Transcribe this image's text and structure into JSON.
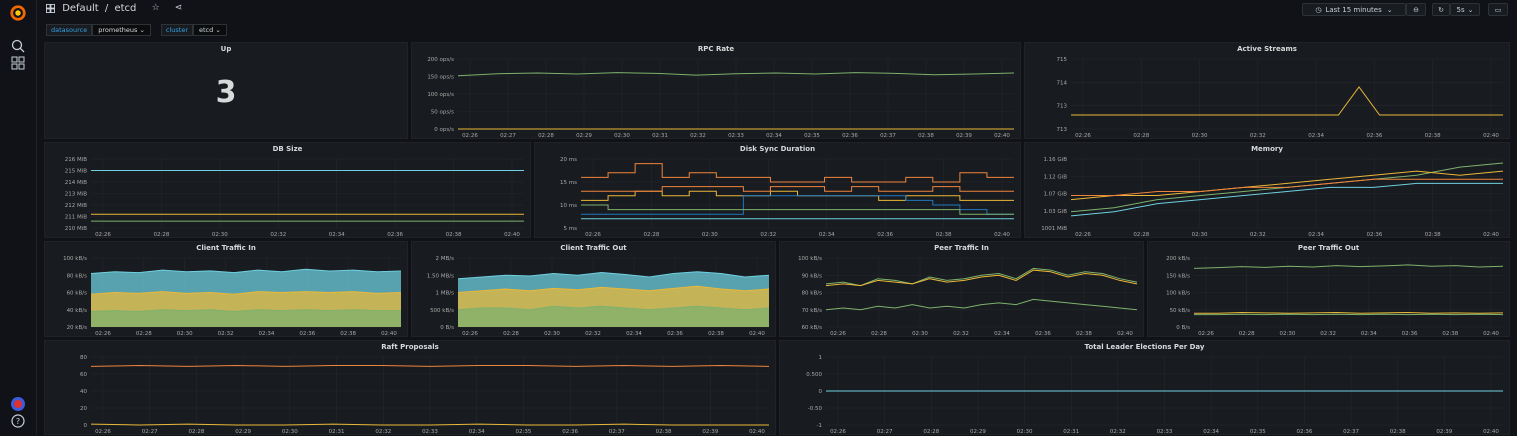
{
  "header": {
    "folder": "Default",
    "separator": "/",
    "title": "etcd",
    "time_range": "Last 15 minutes",
    "refresh": "5s"
  },
  "variables": [
    {
      "label": "datasource",
      "value": "prometheus"
    },
    {
      "label": "cluster",
      "value": "etcd"
    }
  ],
  "colors": {
    "green": "#7eb26d",
    "yellow": "#eab839",
    "orange": "#ef843c",
    "blue": "#6ed0e0",
    "lightblue": "#1f78c1",
    "grid": "#25272b"
  },
  "panels": {
    "up": {
      "title": "Up",
      "value": "3"
    },
    "rpc": {
      "title": "RPC Rate"
    },
    "streams": {
      "title": "Active Streams"
    },
    "dbsize": {
      "title": "DB Size"
    },
    "disk": {
      "title": "Disk Sync Duration"
    },
    "memory": {
      "title": "Memory"
    },
    "cin": {
      "title": "Client Traffic In"
    },
    "cout": {
      "title": "Client Traffic Out"
    },
    "pin": {
      "title": "Peer Traffic In"
    },
    "pout": {
      "title": "Peer Traffic Out"
    },
    "raft": {
      "title": "Raft Proposals"
    },
    "leader": {
      "title": "Total Leader Elections Per Day"
    }
  },
  "chart_data": [
    {
      "id": "rpc",
      "type": "line",
      "x": [
        "02:26",
        "02:27",
        "02:28",
        "02:29",
        "02:30",
        "02:31",
        "02:32",
        "02:33",
        "02:34",
        "02:35",
        "02:36",
        "02:37",
        "02:38",
        "02:39",
        "02:40"
      ],
      "yticks": [
        "200 ops/s",
        "150 ops/s",
        "100 ops/s",
        "50 ops/s",
        "0 ops/s"
      ],
      "ylim": [
        0,
        200
      ],
      "series": [
        {
          "color": "green",
          "values": [
            152,
            158,
            160,
            157,
            161,
            159,
            154,
            158,
            160,
            157,
            161,
            159,
            155,
            157,
            160
          ]
        },
        {
          "color": "yellow",
          "values": [
            0,
            0,
            0,
            0,
            0,
            0,
            0,
            0,
            0,
            0,
            0,
            0,
            0,
            0,
            0
          ]
        }
      ]
    },
    {
      "id": "streams",
      "type": "line",
      "x": [
        "02:26",
        "02:28",
        "02:30",
        "02:32",
        "02:34",
        "02:36",
        "02:38",
        "02:40"
      ],
      "yticks": [
        "715",
        "714",
        "713",
        "713"
      ],
      "ylim": [
        712.5,
        715
      ],
      "series": [
        {
          "color": "yellow",
          "values": [
            713,
            713,
            713,
            713,
            713,
            713,
            713,
            713,
            713,
            713,
            713,
            713,
            713,
            713,
            714,
            713,
            713,
            713,
            713,
            713,
            713,
            713
          ]
        }
      ]
    },
    {
      "id": "dbsize",
      "type": "line",
      "x": [
        "02:26",
        "02:28",
        "02:30",
        "02:32",
        "02:34",
        "02:36",
        "02:38",
        "02:40"
      ],
      "yticks": [
        "216 MiB",
        "215 MiB",
        "214 MiB",
        "213 MiB",
        "212 MiB",
        "211 MiB",
        "210 MiB"
      ],
      "ylim": [
        210,
        216
      ],
      "series": [
        {
          "color": "blue",
          "values": [
            215,
            215,
            215,
            215,
            215,
            215,
            215,
            215
          ]
        },
        {
          "color": "yellow",
          "values": [
            211.2,
            211.2,
            211.2,
            211.2,
            211.2,
            211.2,
            211.2,
            211.2
          ]
        },
        {
          "color": "green",
          "values": [
            210.6,
            210.6,
            210.6,
            210.6,
            210.6,
            210.6,
            210.6,
            210.6
          ]
        }
      ]
    },
    {
      "id": "disk",
      "type": "step",
      "x": [
        "02:26",
        "02:28",
        "02:30",
        "02:32",
        "02:34",
        "02:36",
        "02:38",
        "02:40"
      ],
      "yticks": [
        "20 ms",
        "15 ms",
        "10 ms",
        "5 ms"
      ],
      "ylim": [
        5,
        20
      ],
      "series": [
        {
          "color": "orange",
          "values": [
            16,
            17,
            19,
            16,
            17,
            16,
            16,
            15,
            15,
            16,
            15,
            15,
            16,
            15,
            17,
            16
          ]
        },
        {
          "color": "yellow",
          "values": [
            11,
            12,
            13,
            12,
            13,
            12,
            12,
            13,
            12,
            12,
            12,
            11,
            12,
            12,
            11,
            11
          ]
        },
        {
          "color": "orange",
          "values": [
            13,
            13,
            13,
            14,
            14,
            14,
            13,
            14,
            14,
            13,
            14,
            13,
            13,
            14,
            13,
            13
          ]
        },
        {
          "color": "lightblue",
          "values": [
            8,
            8,
            8,
            8,
            8,
            8,
            12,
            12,
            12,
            12,
            12,
            12,
            11,
            10,
            9,
            8
          ]
        },
        {
          "color": "blue",
          "values": [
            7,
            7,
            7,
            7,
            7,
            7,
            7,
            7,
            7,
            7,
            7,
            7,
            7,
            7,
            7,
            7
          ]
        },
        {
          "color": "green",
          "values": [
            10,
            9,
            9,
            9,
            9,
            9,
            9,
            9,
            9,
            9,
            9,
            9,
            9,
            9,
            8,
            8
          ]
        }
      ]
    },
    {
      "id": "memory",
      "type": "line",
      "x": [
        "02:26",
        "02:28",
        "02:30",
        "02:32",
        "02:34",
        "02:36",
        "02:38",
        "02:40"
      ],
      "yticks": [
        "1.16 GiB",
        "1.12 GiB",
        "1.07 GiB",
        "1.03 GiB",
        "1001 MiB"
      ],
      "ylim": [
        1.0,
        1.17
      ],
      "series": [
        {
          "color": "green",
          "values": [
            1.04,
            1.05,
            1.07,
            1.08,
            1.09,
            1.1,
            1.11,
            1.12,
            1.13,
            1.15,
            1.16
          ]
        },
        {
          "color": "yellow",
          "values": [
            1.07,
            1.08,
            1.08,
            1.09,
            1.1,
            1.11,
            1.12,
            1.13,
            1.14,
            1.13,
            1.14
          ]
        },
        {
          "color": "orange",
          "values": [
            1.08,
            1.08,
            1.09,
            1.09,
            1.1,
            1.1,
            1.11,
            1.12,
            1.12,
            1.12,
            1.12
          ]
        },
        {
          "color": "blue",
          "values": [
            1.03,
            1.04,
            1.06,
            1.07,
            1.08,
            1.09,
            1.1,
            1.1,
            1.11,
            1.11,
            1.11
          ]
        }
      ]
    },
    {
      "id": "cin",
      "type": "area",
      "x": [
        "02:26",
        "02:28",
        "02:30",
        "02:32",
        "02:34",
        "02:36",
        "02:38",
        "02:40"
      ],
      "yticks": [
        "100 kB/s",
        "80 kB/s",
        "60 kB/s",
        "40 kB/s",
        "20 kB/s"
      ],
      "ylim": [
        20,
        100
      ],
      "series": [
        {
          "color": "blue",
          "values": [
            82,
            84,
            83,
            86,
            84,
            85,
            83,
            86,
            84,
            87,
            85,
            86,
            84,
            85
          ]
        },
        {
          "color": "yellow",
          "values": [
            58,
            60,
            59,
            61,
            59,
            60,
            58,
            61,
            60,
            61,
            60,
            61,
            59,
            60
          ]
        },
        {
          "color": "green",
          "values": [
            38,
            39,
            38,
            40,
            39,
            40,
            38,
            40,
            39,
            40,
            39,
            40,
            39,
            39
          ]
        }
      ]
    },
    {
      "id": "cout",
      "type": "area",
      "x": [
        "02:26",
        "02:28",
        "02:30",
        "02:32",
        "02:34",
        "02:36",
        "02:38",
        "02:40"
      ],
      "yticks": [
        "2 MB/s",
        "1.50 MB/s",
        "1 MB/s",
        "500 kB/s",
        "0 B/s"
      ],
      "ylim": [
        0,
        2
      ],
      "series": [
        {
          "color": "blue",
          "values": [
            1.4,
            1.45,
            1.5,
            1.48,
            1.55,
            1.5,
            1.58,
            1.52,
            1.45,
            1.55,
            1.6,
            1.55,
            1.45,
            1.5
          ]
        },
        {
          "color": "yellow",
          "values": [
            1.0,
            1.05,
            1.1,
            1.05,
            1.12,
            1.08,
            1.15,
            1.1,
            1.05,
            1.12,
            1.18,
            1.1,
            1.05,
            1.1
          ]
        },
        {
          "color": "green",
          "values": [
            0.5,
            0.55,
            0.55,
            0.5,
            0.6,
            0.55,
            0.6,
            0.55,
            0.5,
            0.55,
            0.6,
            0.55,
            0.5,
            0.55
          ]
        }
      ]
    },
    {
      "id": "pin",
      "type": "line",
      "x": [
        "02:26",
        "02:28",
        "02:30",
        "02:32",
        "02:34",
        "02:36",
        "02:38",
        "02:40"
      ],
      "yticks": [
        "100 kB/s",
        "90 kB/s",
        "80 kB/s",
        "70 kB/s",
        "60 kB/s"
      ],
      "ylim": [
        60,
        100
      ],
      "series": [
        {
          "color": "green",
          "values": [
            85,
            86,
            84,
            88,
            87,
            85,
            89,
            87,
            88,
            90,
            91,
            88,
            94,
            93,
            90,
            92,
            91,
            88,
            86
          ]
        },
        {
          "color": "yellow",
          "values": [
            84,
            85,
            84,
            87,
            86,
            85,
            88,
            86,
            87,
            89,
            90,
            87,
            93,
            92,
            89,
            91,
            90,
            87,
            85
          ]
        },
        {
          "color": "green",
          "values": [
            70,
            71,
            70,
            72,
            71,
            73,
            71,
            72,
            71,
            73,
            74,
            73,
            76,
            75,
            74,
            73,
            72,
            71,
            70
          ]
        }
      ]
    },
    {
      "id": "pout",
      "type": "line",
      "x": [
        "02:26",
        "02:28",
        "02:30",
        "02:32",
        "02:34",
        "02:36",
        "02:38",
        "02:40"
      ],
      "yticks": [
        "200 kB/s",
        "150 kB/s",
        "100 kB/s",
        "50 kB/s",
        "0 B/s"
      ],
      "ylim": [
        0,
        200
      ],
      "series": [
        {
          "color": "green",
          "values": [
            170,
            172,
            175,
            173,
            176,
            174,
            178,
            175,
            177,
            180,
            176,
            178,
            174,
            176
          ]
        },
        {
          "color": "yellow",
          "values": [
            40,
            40,
            42,
            41,
            40,
            41,
            42,
            40,
            41,
            42,
            40,
            41,
            40,
            41
          ]
        },
        {
          "color": "green",
          "values": [
            36,
            36,
            37,
            36,
            37,
            36,
            37,
            36,
            37,
            36,
            37,
            36,
            37,
            36
          ]
        }
      ]
    },
    {
      "id": "raft",
      "type": "line",
      "x": [
        "02:26",
        "02:27",
        "02:28",
        "02:29",
        "02:30",
        "02:31",
        "02:32",
        "02:33",
        "02:34",
        "02:35",
        "02:36",
        "02:37",
        "02:38",
        "02:39",
        "02:40"
      ],
      "yticks": [
        "80",
        "60",
        "40",
        "20",
        "0"
      ],
      "ylim": [
        0,
        80
      ],
      "series": [
        {
          "color": "orange",
          "values": [
            69,
            70,
            69,
            70,
            69,
            70,
            70,
            69,
            70,
            70,
            69,
            70,
            69,
            70,
            69
          ]
        },
        {
          "color": "yellow",
          "values": [
            1,
            0,
            1,
            0,
            0,
            1,
            0,
            0,
            1,
            0,
            0,
            1,
            0,
            0,
            0
          ]
        }
      ]
    },
    {
      "id": "leader",
      "type": "line",
      "x": [
        "02:26",
        "02:27",
        "02:28",
        "02:29",
        "02:30",
        "02:31",
        "02:32",
        "02:33",
        "02:34",
        "02:35",
        "02:36",
        "02:37",
        "02:38",
        "02:39",
        "02:40"
      ],
      "yticks": [
        "1",
        "0.500",
        "0",
        "-0.50",
        "-1"
      ],
      "ylim": [
        -1,
        1
      ],
      "series": [
        {
          "color": "blue",
          "values": [
            0,
            0,
            0,
            0,
            0,
            0,
            0,
            0,
            0,
            0,
            0,
            0,
            0,
            0,
            0
          ]
        }
      ]
    }
  ]
}
